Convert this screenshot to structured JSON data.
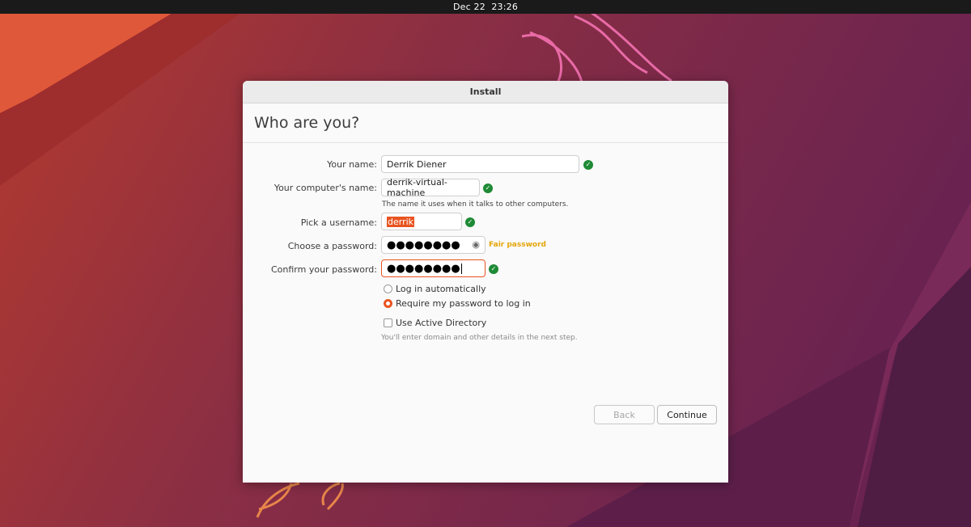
{
  "topbar": {
    "date": "Dec 22",
    "time": "23:26"
  },
  "window": {
    "title": "Install",
    "heading": "Who are you?"
  },
  "form": {
    "name": {
      "label": "Your name:",
      "value": "Derrik Diener"
    },
    "computer": {
      "label": "Your computer's name:",
      "value": "derrik-virtual-machine",
      "hint": "The name it uses when it talks to other computers."
    },
    "username": {
      "label": "Pick a username:",
      "value": "derrik"
    },
    "password": {
      "label": "Choose a password:",
      "value": "●●●●●●●●",
      "strength": "Fair password"
    },
    "confirm": {
      "label": "Confirm your password:",
      "value": "●●●●●●●●"
    },
    "login_auto": {
      "label": "Log in automatically",
      "selected": false
    },
    "login_password": {
      "label": "Require my password to log in",
      "selected": true
    },
    "active_directory": {
      "label": "Use Active Directory",
      "checked": false,
      "hint": "You'll enter domain and other details in the next step."
    }
  },
  "buttons": {
    "back": "Back",
    "continue": "Continue"
  },
  "colors": {
    "accent": "#e95420",
    "valid": "#1e8a35",
    "strength": "#e5a50a"
  }
}
